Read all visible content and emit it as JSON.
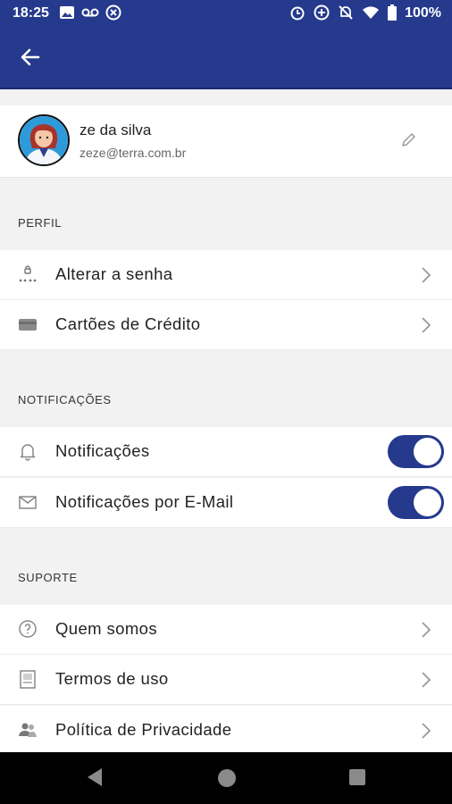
{
  "status_bar": {
    "time": "18:25",
    "battery": "100%"
  },
  "app_bar": {
    "back_icon": "arrow-left-icon"
  },
  "profile": {
    "name": "ze da silva",
    "email": "zeze@terra.com.br",
    "edit_icon": "pencil-icon"
  },
  "sections": {
    "perfil": {
      "title": "PERFIL",
      "items": [
        {
          "label": "Alterar a senha",
          "icon": "password-lock-icon"
        },
        {
          "label": "Cartões de Crédito",
          "icon": "credit-card-icon"
        }
      ]
    },
    "notificacoes": {
      "title": "NOTIFICAÇÕES",
      "items": [
        {
          "label": "Notificações",
          "icon": "bell-icon",
          "enabled": true
        },
        {
          "label": "Notificações por E-Mail",
          "icon": "mail-icon",
          "enabled": true
        }
      ]
    },
    "suporte": {
      "title": "SUPORTE",
      "items": [
        {
          "label": "Quem somos",
          "icon": "question-circle-icon"
        },
        {
          "label": "Termos de uso",
          "icon": "document-icon"
        },
        {
          "label": "Política de Privacidade",
          "icon": "privacy-users-icon"
        }
      ]
    }
  },
  "colors": {
    "primary": "#253a8d",
    "background": "#f2f2f2",
    "toggle_on": "#253a8d"
  }
}
